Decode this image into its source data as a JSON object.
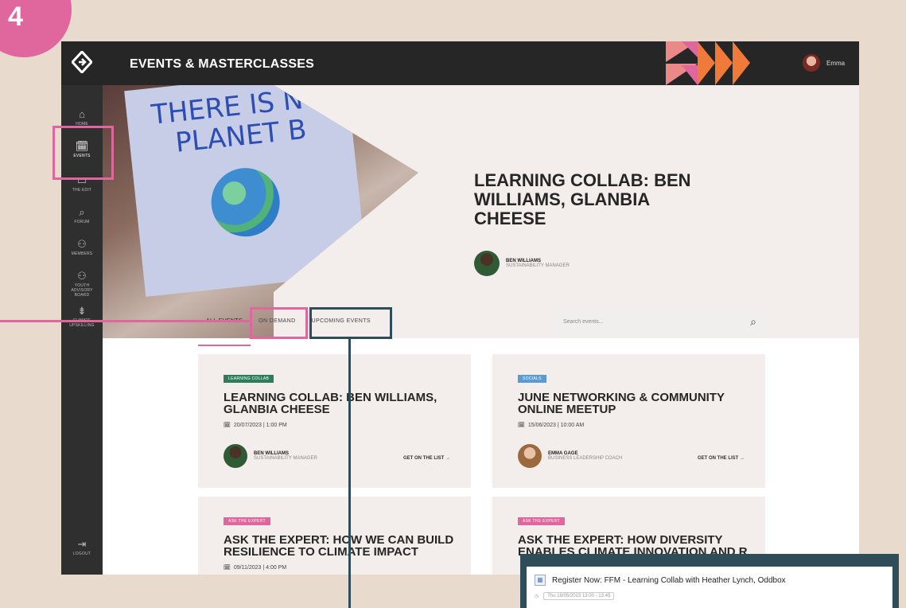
{
  "step_number": "4",
  "header": {
    "title": "EVENTS & MASTERCLASSES",
    "user_name": "Emma"
  },
  "sidebar": {
    "items": [
      {
        "icon": "⌂",
        "label": "HOME"
      },
      {
        "icon": "🗓",
        "label": "EVENTS"
      },
      {
        "icon": "▭",
        "label": "THE EDIT"
      },
      {
        "icon": "⌕",
        "label": "FORUM"
      },
      {
        "icon": "⚇",
        "label": "MEMBERS"
      },
      {
        "icon": "⚇",
        "label": "YOUTH ADVISORY BOARD"
      },
      {
        "icon": "⇟",
        "label": "CLIMATE UPSKILLING"
      },
      {
        "icon": "⇥",
        "label": "LOGOUT"
      }
    ]
  },
  "hero": {
    "sign_lines": [
      "THERE IS NO",
      "PLANET B"
    ],
    "title": "LEARNING COLLAB: BEN WILLIAMS, GLANBIA CHEESE",
    "host_name": "BEN WILLIAMS",
    "host_role": "SUSTAINABILITY MANAGER"
  },
  "tabs": [
    {
      "label": "ALL EVENTS"
    },
    {
      "label": "ON DEMAND"
    },
    {
      "label": "UPCOMING EVENTS"
    }
  ],
  "search": {
    "placeholder": "Search events..."
  },
  "cards": [
    {
      "tag": "LEARNING COLLAB",
      "tag_color": "#2e7d5b",
      "title": "LEARNING COLLAB: BEN WILLIAMS, GLANBIA CHEESE",
      "date": "20/07/2023 | 1:00 PM",
      "host_name": "BEN WILLIAMS",
      "host_role": "SUSTAINABILITY MANAGER",
      "cta": "GET ON THE LIST →"
    },
    {
      "tag": "SOCIALS",
      "tag_color": "#5b9bd5",
      "title": "JUNE NETWORKING & COMMUNITY ONLINE MEETUP",
      "date": "15/06/2023 | 10:00 AM",
      "host_name": "EMMA GAGE",
      "host_role": "BUSINESS LEADERSHIP COACH",
      "cta": "GET ON THE LIST →"
    },
    {
      "tag": "ASK THE EXPERT",
      "tag_color": "#e0669e",
      "title": "ASK THE EXPERT: HOW WE CAN BUILD RESILIENCE TO CLIMATE IMPACT",
      "date": "09/11/2023 | 4:00 PM"
    },
    {
      "tag": "ASK THE EXPERT",
      "tag_color": "#e0669e",
      "title": "ASK THE EXPERT: HOW DIVERSITY ENABLES CLIMATE INNOVATION AND R"
    }
  ],
  "popup": {
    "title": "Register Now: FFM - Learning Collab with Heather Lynch, Oddbox",
    "datetime": "Thu 18/05/2023 13:00 - 13:45"
  },
  "colors": {
    "accent_pink": "#e0669e",
    "dark_teal": "#2f4d59",
    "topbar": "#262626",
    "background": "#e8dbcd"
  }
}
